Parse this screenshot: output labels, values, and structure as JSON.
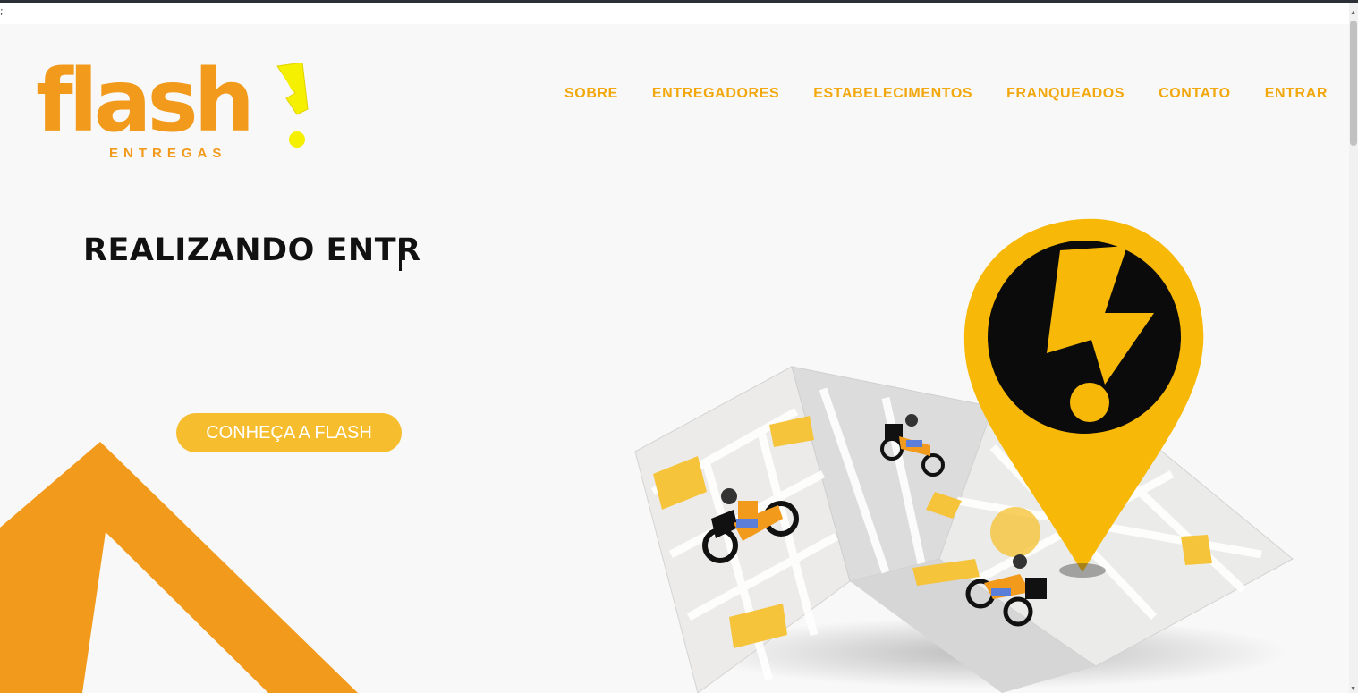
{
  "page": {
    "stray_text": ";"
  },
  "logo": {
    "word": "flash",
    "sub": "ENTREGAS"
  },
  "nav": {
    "items": [
      {
        "label": "SOBRE"
      },
      {
        "label": "ENTREGADORES"
      },
      {
        "label": "ESTABELECIMENTOS"
      },
      {
        "label": "FRANQUEADOS"
      },
      {
        "label": "CONTATO"
      },
      {
        "label": "ENTRAR"
      }
    ]
  },
  "hero": {
    "headline": "REALIZANDO ENTR",
    "cta_label": "CONHEÇA A FLASH"
  },
  "colors": {
    "brand_orange": "#f29a1b",
    "nav_gold": "#f2a80d",
    "cta_yellow": "#f6be2f",
    "bolt_yellow": "#f5f000",
    "pin_yellow": "#f7b808"
  },
  "icons": {
    "logo_bolt": "lightning-exclamation-icon",
    "map_pin": "map-pin-lightning-icon",
    "map": "folded-map-illustration",
    "courier": "delivery-motorbike-icon"
  }
}
